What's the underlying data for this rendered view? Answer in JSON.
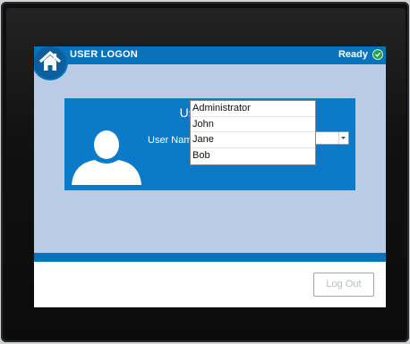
{
  "titlebar": {
    "title": "USER LOGON",
    "status": "Ready"
  },
  "icons": {
    "home": "home-icon",
    "status": "ready-check-icon",
    "user": "user-avatar-icon",
    "dropdown": "chevron-down-icon"
  },
  "logon": {
    "heading": "User logon",
    "user_name_label": "User Name",
    "required_mark": "*",
    "user_name_value": "",
    "options": [
      "Administrator",
      "John",
      "Jane",
      "Bob"
    ]
  },
  "footer": {
    "logout_label": "Log Out"
  },
  "colors": {
    "accent": "#0873ba",
    "panel": "#0c7ac6",
    "screen_bg": "#b8cde5",
    "ready": "#1fa34a"
  }
}
